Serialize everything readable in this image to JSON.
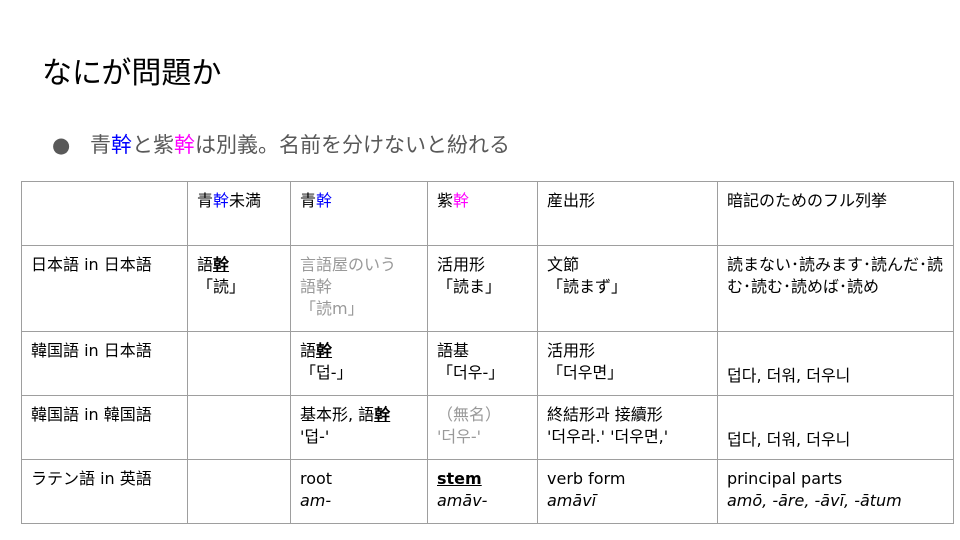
{
  "slide": {
    "title": "なにが問題か",
    "bullet": {
      "dot": "●",
      "p1": "青",
      "p2": "幹",
      "p3": "と紫",
      "p4": "幹",
      "p5": "は別義。名前を分けないと紛れる"
    }
  },
  "colors": {
    "blue": "#0000ff",
    "magenta": "#ff00ff",
    "gray": "#999999",
    "bullet_text": "#595959"
  },
  "table": {
    "headers": {
      "h0": "",
      "h1a": "青",
      "h1b": "幹",
      "h1c": "未満",
      "h2a": "青",
      "h2b": "幹",
      "h3a": "紫",
      "h3b": "幹",
      "h4": "産出形",
      "h5": "暗記のためのフル列挙"
    },
    "row1": {
      "label": "日本語 in 日本語",
      "c1a": "語",
      "c1b": "幹",
      "c1c": "「読」",
      "c2a": "言語屋のいう",
      "c2b": "語幹",
      "c2c": "「読m」",
      "c3a": "活用形",
      "c3b": "「読ま」",
      "c4a": "文節",
      "c4b": "「読まず」",
      "c5": "読まない･読みます･読んだ･読む･読む･読めば･読め"
    },
    "row2": {
      "label": "韓国語 in 日本語",
      "c2a": "語",
      "c2b": "幹",
      "c2c": "「덥-」",
      "c3a": "語基",
      "c3b": "「더우-」",
      "c4a": "活用形",
      "c4b": "「더우면」",
      "c5": "덥다, 더워, 더우니"
    },
    "row3": {
      "label": "韓国語 in 韓国語",
      "c2a": "基本形, 語",
      "c2b": "幹",
      "c2c": "'덥-'",
      "c3a": "（無名）",
      "c3b": "'더우-'",
      "c4a": "終結形과 接續形",
      "c4b": "'더우라.' '더우면,'",
      "c5": "덥다, 더워, 더우니"
    },
    "row4": {
      "label": "ラテン語 in 英語",
      "c2a": "root",
      "c2b": "am-",
      "c3a": "stem",
      "c3b": "amāv-",
      "c4a": "verb form",
      "c4b": "amāvī",
      "c5a": "principal parts",
      "c5b": "amō, -āre, -āvī, -ātum"
    }
  }
}
